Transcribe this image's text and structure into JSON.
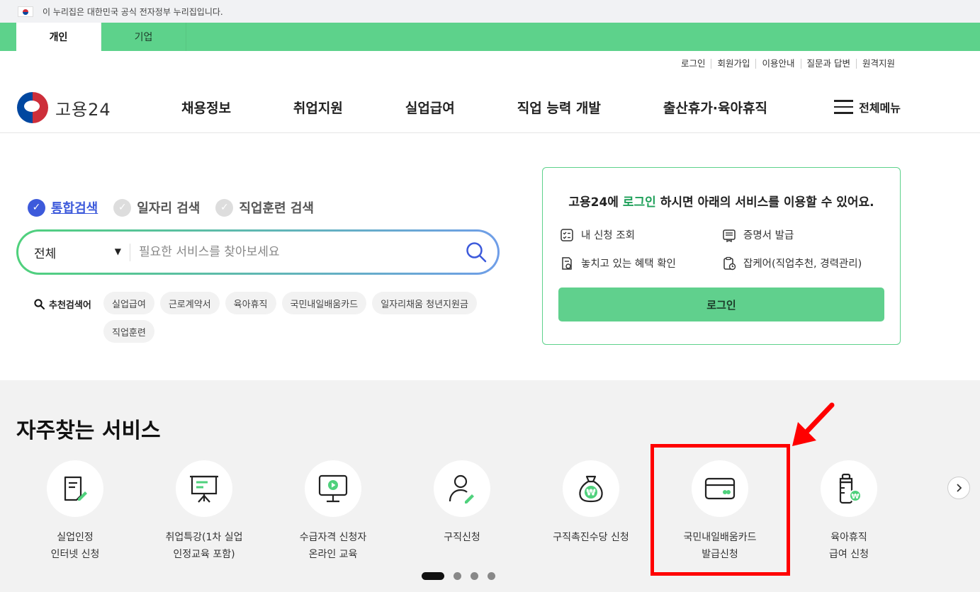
{
  "gov_banner": {
    "text": "이 누리집은 대한민국 공식 전자정부 누리집입니다."
  },
  "audience_tabs": [
    {
      "label": "개인"
    },
    {
      "label": "기업"
    }
  ],
  "util_links": [
    "로그인",
    "회원가입",
    "이용안내",
    "질문과 답변",
    "원격지원"
  ],
  "logo": {
    "text": "고용24"
  },
  "gnb": [
    "채용정보",
    "취업지원",
    "실업급여",
    "직업 능력 개발",
    "출산휴가·육아휴직"
  ],
  "all_menu": {
    "label": "전체메뉴"
  },
  "search": {
    "tabs": [
      "통합검색",
      "일자리 검색",
      "직업훈련 검색"
    ],
    "select_value": "전체",
    "placeholder": "필요한 서비스를 찾아보세요",
    "recommend_label": "추천검색어",
    "keywords": [
      "실업급여",
      "근로계약서",
      "육아휴직",
      "국민내일배움카드",
      "일자리채움 청년지원금",
      "직업훈련"
    ]
  },
  "login_box": {
    "title_prefix": "고용24에 ",
    "title_highlight": "로그인",
    "title_suffix": " 하시면 아래의 서비스를 이용할 수 있어요.",
    "features": [
      "내 신청 조회",
      "증명서 발급",
      "놓치고 있는 혜택 확인",
      "잡케어(직업추천, 경력관리)"
    ],
    "button": "로그인"
  },
  "frequent": {
    "title": "자주찾는 서비스",
    "services": [
      {
        "label": "실업인정\n인터넷 신청",
        "icon": "document-pen-icon"
      },
      {
        "label": "취업특강(1차 실업\n인정교육 포함)",
        "icon": "presentation-board-icon"
      },
      {
        "label": "수급자격 신청자\n온라인 교육",
        "icon": "monitor-play-icon"
      },
      {
        "label": "구직신청",
        "icon": "person-pen-icon"
      },
      {
        "label": "구직촉진수당 신청",
        "icon": "money-bag-won-icon"
      },
      {
        "label": "국민내일배움카드\n발급신청",
        "icon": "card-icon"
      },
      {
        "label": "육아휴직\n급여 신청",
        "icon": "baby-bottle-won-icon"
      }
    ]
  },
  "colors": {
    "brand_green": "#5dd28b",
    "accent_blue": "#3d5adb",
    "annotation_red": "#ff0000"
  }
}
